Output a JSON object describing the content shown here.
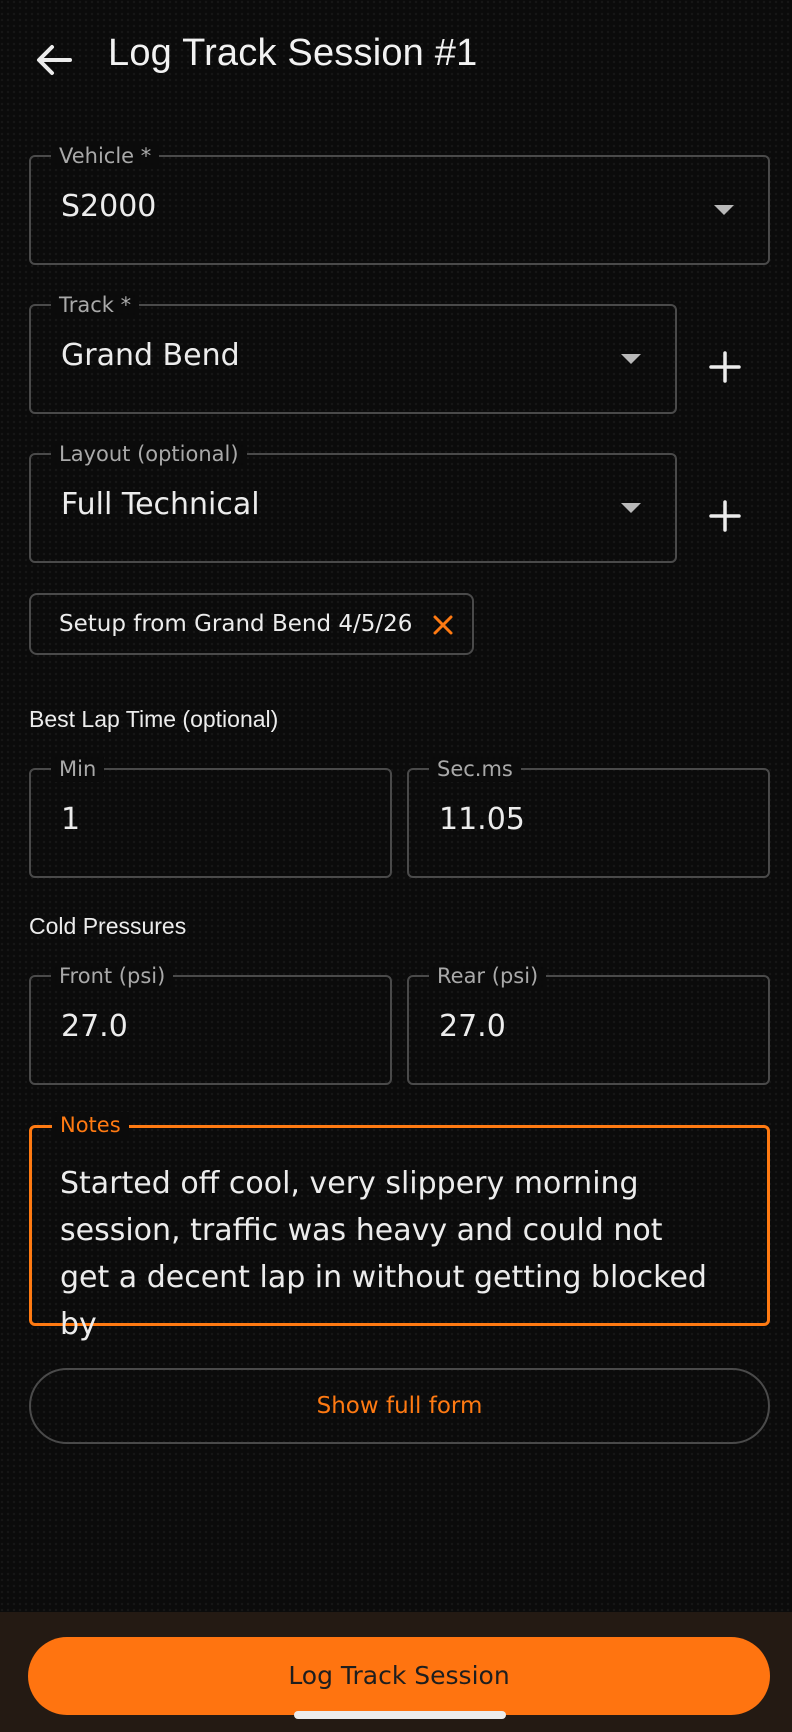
{
  "header": {
    "title": "Log Track Session #1",
    "back_icon": "arrow-left-icon"
  },
  "vehicle": {
    "label": "Vehicle *",
    "value": "S2000"
  },
  "track": {
    "label": "Track *",
    "value": "Grand Bend"
  },
  "layout": {
    "label": "Layout (optional)",
    "value": "Full Technical"
  },
  "setup_chip": {
    "label": "Setup from Grand Bend 4/5/26"
  },
  "best_lap": {
    "section_label": "Best Lap Time (optional)",
    "min_label": "Min",
    "min_value": "1",
    "sec_label": "Sec.ms",
    "sec_value": "11.05"
  },
  "cold_pressures": {
    "section_label": "Cold Pressures",
    "front_label": "Front (psi)",
    "front_value": "27.0",
    "rear_label": "Rear (psi)",
    "rear_value": "27.0"
  },
  "notes": {
    "label": "Notes",
    "value": "Started off cool, very slippery morning session, traffic was heavy and could not get a decent lap in without getting blocked by"
  },
  "show_full_form": "Show full form",
  "submit": "Log Track Session",
  "colors": {
    "accent": "#ff7a12",
    "background": "#0b0b0b",
    "bottom_bar": "#241a13"
  }
}
